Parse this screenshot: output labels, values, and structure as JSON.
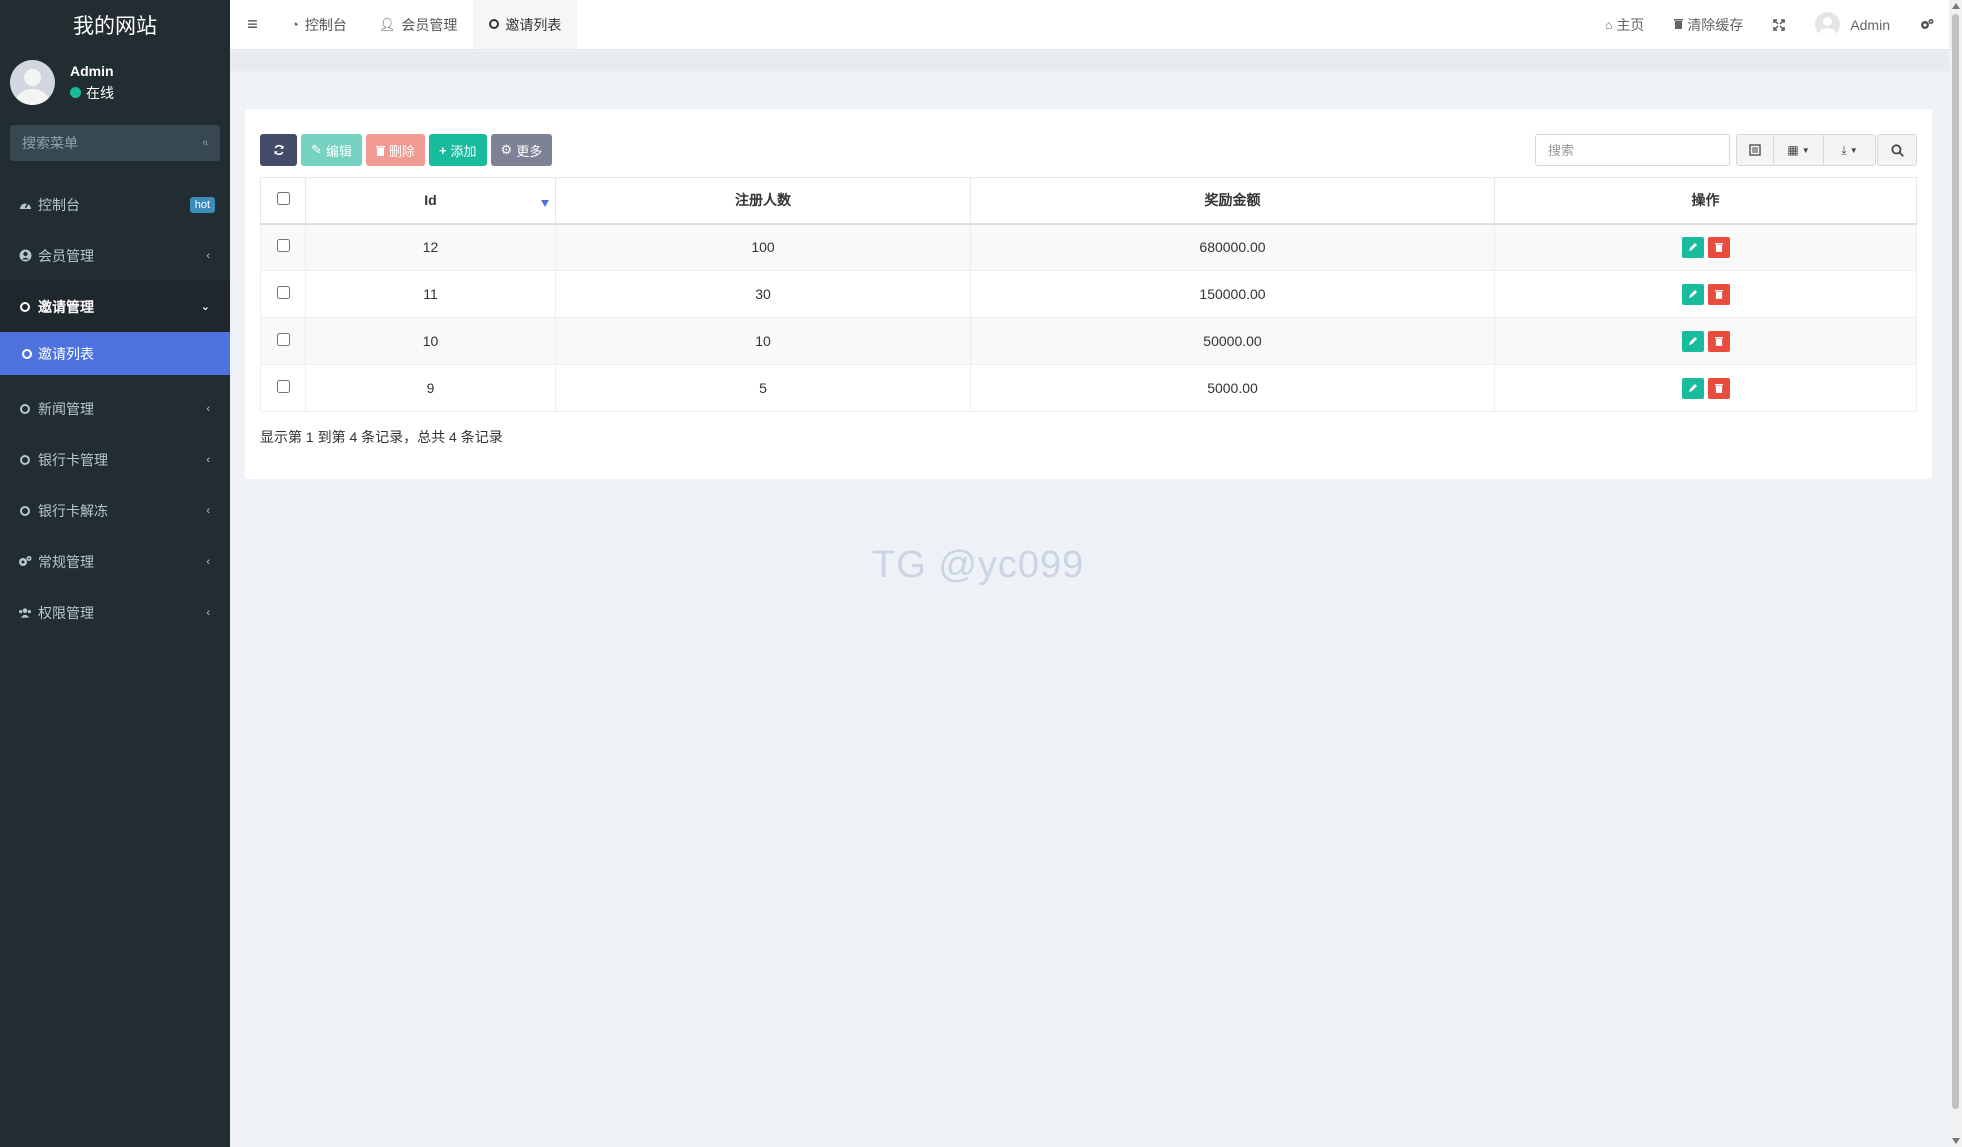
{
  "sidebar": {
    "logo": "我的网站",
    "user": {
      "name": "Admin",
      "status": "在线"
    },
    "search_placeholder": "搜索菜单",
    "items": [
      {
        "label": "控制台",
        "badge": "hot"
      },
      {
        "label": "会员管理"
      },
      {
        "label": "邀请管理",
        "submenu": [
          {
            "label": "邀请列表"
          }
        ]
      },
      {
        "label": "新闻管理"
      },
      {
        "label": "银行卡管理"
      },
      {
        "label": "银行卡解冻"
      },
      {
        "label": "常规管理"
      },
      {
        "label": "权限管理"
      }
    ]
  },
  "navbar": {
    "tabs": [
      {
        "label": "控制台"
      },
      {
        "label": "会员管理"
      },
      {
        "label": "邀请列表"
      }
    ],
    "home_label": "主页",
    "clear_cache_label": "清除缓存",
    "user_name": "Admin"
  },
  "toolbar": {
    "edit_label": "编辑",
    "delete_label": "删除",
    "add_label": "添加",
    "more_label": "更多",
    "search_placeholder": "搜索"
  },
  "table": {
    "columns": [
      "Id",
      "注册人数",
      "奖励金额",
      "操作"
    ],
    "rows": [
      {
        "id": "12",
        "registrations": "100",
        "reward": "680000.00"
      },
      {
        "id": "11",
        "registrations": "30",
        "reward": "150000.00"
      },
      {
        "id": "10",
        "registrations": "10",
        "reward": "50000.00"
      },
      {
        "id": "9",
        "registrations": "5",
        "reward": "5000.00"
      }
    ]
  },
  "pagination_info": "显示第 1 到第 4 条记录，总共 4 条记录",
  "watermark": "TG @yc099",
  "colors": {
    "sidebar_bg": "#222d32",
    "active_submenu": "#4e73df",
    "success": "#18bc9c",
    "danger": "#e74c3c"
  }
}
